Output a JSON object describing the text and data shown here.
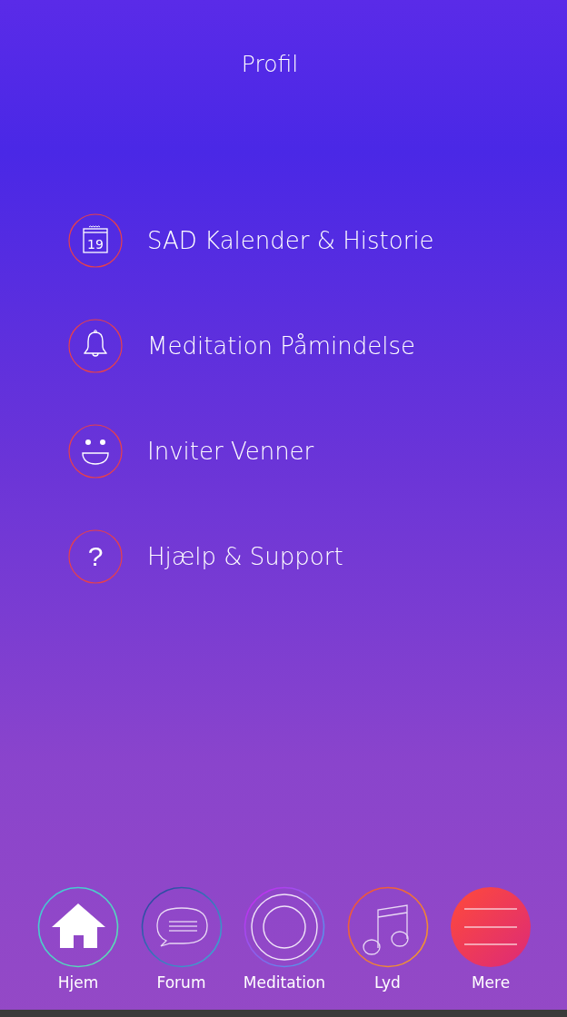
{
  "header": {
    "title": "Profil"
  },
  "menu": [
    {
      "kind": "calendar",
      "label": "SAD Kalender & Historie",
      "icon_text": "19"
    },
    {
      "kind": "bell",
      "label": "Meditation Påmindelse"
    },
    {
      "kind": "smile",
      "label": "Inviter Venner"
    },
    {
      "kind": "help",
      "label": "Hjælp & Support",
      "icon_text": "?"
    }
  ],
  "tabs": [
    {
      "kind": "home",
      "label": "Hjem",
      "selected": false
    },
    {
      "kind": "forum",
      "label": "Forum",
      "selected": false
    },
    {
      "kind": "meditation",
      "label": "Meditation",
      "selected": false
    },
    {
      "kind": "music",
      "label": "Lyd",
      "selected": false
    },
    {
      "kind": "menu",
      "label": "Mere",
      "selected": true
    }
  ]
}
